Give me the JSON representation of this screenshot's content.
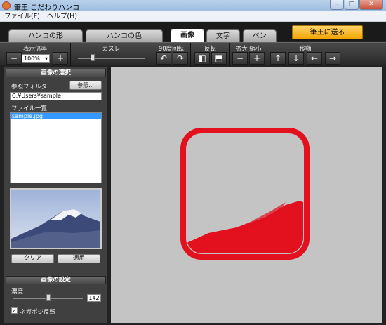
{
  "window": {
    "title": "筆王 こだわりハンコ"
  },
  "menu": [
    "ファイル(F)",
    "ヘルプ(H)"
  ],
  "tabs": [
    "ハンコの形",
    "ハンコの色",
    "画像",
    "文字",
    "ペン"
  ],
  "send_button": "筆王に送る",
  "toolbar": {
    "zoom_label": "表示倍率",
    "zoom_value": "100%",
    "zoom_minus": "−",
    "zoom_plus": "+",
    "kasure_label": "カスレ",
    "rotate_label": "90度回転",
    "rotate_left": "↶",
    "rotate_right": "↷",
    "flip_label": "反転",
    "flip_h": "◧",
    "flip_v": "⬒",
    "scale_label": "拡大 縮小",
    "scale_minus": "−",
    "scale_plus": "+",
    "move_label": "移動",
    "move_up": "↑",
    "move_down": "↓",
    "move_left": "←",
    "move_right": "→"
  },
  "image_select": {
    "title": "画像の選択",
    "folder_label": "参照フォルダ",
    "browse_button": "参照...",
    "folder_path": "C:¥Users¥sample",
    "file_list_label": "ファイル一覧",
    "files": [
      "sample.jpg"
    ],
    "clear_button": "クリア",
    "apply_button": "適用"
  },
  "image_settings": {
    "title": "画像の設定",
    "density_label": "濃度",
    "density_value": "142",
    "negapoji_label": "ネガポジ反転",
    "negapoji_checked": "✓"
  },
  "colors": {
    "stamp": "#e3101e",
    "accent": "#f3a500",
    "selection": "#3399ff"
  }
}
